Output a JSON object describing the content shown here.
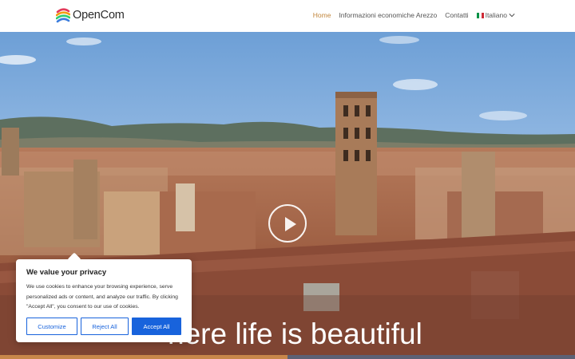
{
  "header": {
    "logo_text": "OpenCom",
    "nav": [
      {
        "label": "Home",
        "active": true
      },
      {
        "label": "Informazioni economiche Arezzo",
        "active": false
      },
      {
        "label": "Contatti",
        "active": false
      }
    ],
    "language": "Italiano"
  },
  "hero": {
    "headline": "here life is beautiful",
    "play_icon": "play-circle-icon"
  },
  "cookie": {
    "title": "We value your privacy",
    "text": "We use cookies to enhance your browsing experience, serve personalized ads or content, and analyze our traffic. By clicking \"Accept All\", you consent to our use of cookies.",
    "buttons": {
      "customize": "Customize",
      "reject": "Reject All",
      "accept": "Accept All"
    }
  },
  "colors": {
    "accent": "#c2873d",
    "cookie_blue": "#1863dc",
    "strip_left": "#c9874a",
    "strip_right": "#5c6175"
  }
}
